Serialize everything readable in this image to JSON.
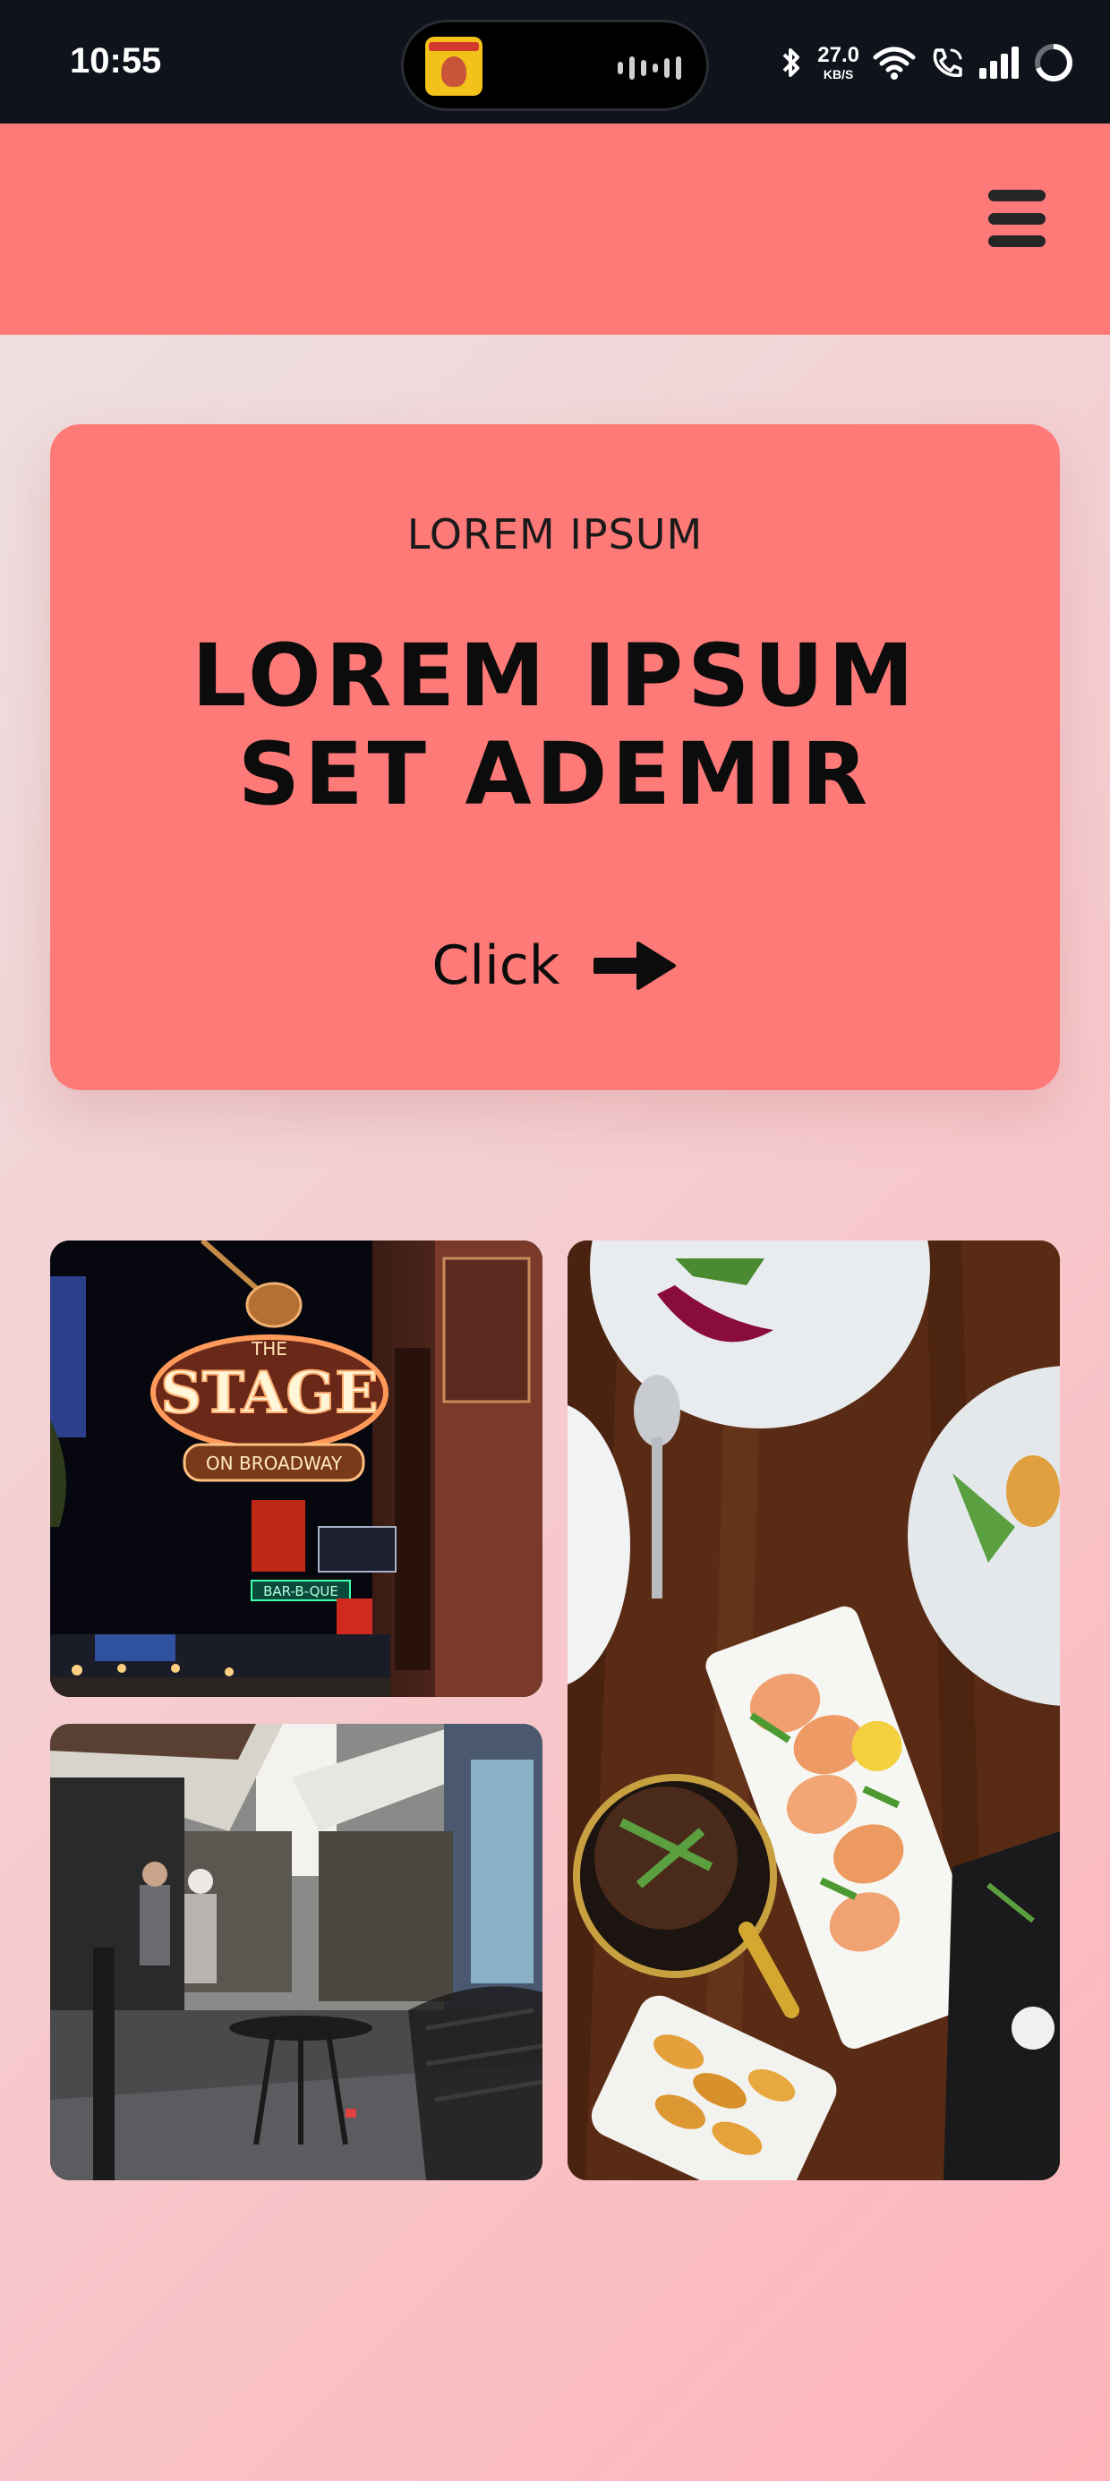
{
  "status_bar": {
    "time": "10:55",
    "net_speed_value": "27.0",
    "net_speed_unit": "KB/S",
    "icons": [
      "bluetooth-icon",
      "wifi-icon",
      "wifi-calling-icon",
      "signal-icon",
      "battery-ring-icon"
    ]
  },
  "header": {
    "menu_icon": "hamburger-menu-icon",
    "accent_color": "#fe7a78"
  },
  "hero": {
    "kicker": "LOREM IPSUM",
    "title_line1": "LOREM IPSUM",
    "title_line2": "SET ADEMIR",
    "cta_label": "Click",
    "cta_icon": "arrow-right-icon"
  },
  "gallery": {
    "images": [
      {
        "name": "neon-stage-sign-photo"
      },
      {
        "name": "street-cafe-photo"
      },
      {
        "name": "shrimp-dinner-table-photo"
      }
    ]
  }
}
